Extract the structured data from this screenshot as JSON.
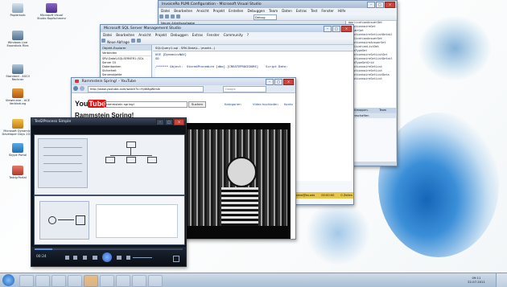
{
  "desktop": {
    "icons": [
      {
        "label": "Papierkorb"
      },
      {
        "label": "Microsoft Visual Studio Kopfschmerz"
      },
      {
        "label": "Windows Live Essentials Files"
      },
      {
        "label": "Standard - ASCII Rechner"
      },
      {
        "label": "Viewer.exe - ACE Verbindung"
      },
      {
        "label": "Microsoft Dynamics Developer Days 2010"
      },
      {
        "label": "Skype Portal"
      },
      {
        "label": "Teddy.Portal"
      }
    ]
  },
  "visual_studio": {
    "title": "InvoiceRo PLMI.Configuration - Microsoft Visual Studio",
    "menu": [
      "Datei",
      "Bearbeiten",
      "Ansicht",
      "Projekt",
      "Erstellen",
      "Debuggen",
      "Team",
      "Daten",
      "Extras",
      "Test",
      "Fenster",
      "Hilfe"
    ],
    "config": "Debug",
    "tab": "Neues Arbeitsaufgabe",
    "solution_items": [
      "ApplicationAnswerGet",
      "QuestionnaireGet",
      "AnswerGet",
      "QuestionnaireSetListDetail",
      "ApplicationAnswerSet",
      "QuestionnaireAnswerSet",
      "ApplicationListDet",
      "DataTypeGet",
      "QuestionnaireSetListGet",
      "QuestionnaireGetListDetail",
      "DataTypeGetGrid",
      "QuestionnaireGetList",
      "QuestionnaireSetList",
      "QuestionnaireGetListData",
      "QuestionnaireSetList"
    ],
    "tabs_right": [
      "Projektmappen-Explorer",
      "Team Explorer"
    ],
    "properties_label": "Eigenschaften"
  },
  "ssms": {
    "title": "Microsoft SQL Server Management Studio",
    "menu": [
      "Datei",
      "Bearbeiten",
      "Ansicht",
      "Projekt",
      "Debuggen",
      "Extras",
      "Fenster",
      "Community",
      "?"
    ],
    "new_query": "Neue Abfrage",
    "explorer_title": "Objekt-Explorer",
    "connect_label": "Verbinden",
    "tree": [
      "SRV-Data\\LSQLSERVER1 (SQL Server 10",
      "Datenbanken",
      "Sicherheit",
      "Serverobjekte",
      "Replikation",
      "Verwaltung",
      "SQL Server-Agent"
    ],
    "query_tab": "SQLQuery1.sql - SRV-Data\\L...\\markt...)",
    "code_lines": [
      "USE [DynamicsNAV]",
      "GO",
      "",
      "/****** Object:  StoredProcedure [dbo].[CREATEPROCEDURE]    Script Date:",
      "",
      "                                        ",
      "                       int, @SessionType ir"
    ],
    "status_right": [
      "tomw@ko.ads",
      "00:00:00",
      "0 Zeilen"
    ]
  },
  "youtube": {
    "title": "Rammstein Spring! - YouTube",
    "url": "http://www.youtube.com/watch?v=9j4K8gWlmIk",
    "search_placeholder": "Google",
    "search_value": "rammstein spring!",
    "search_button": "Suchen",
    "nav": [
      "Kategorien",
      "Video hochladen"
    ],
    "nav_right": "Konto",
    "video_title": "Rammstein Spring!",
    "logo_you": "You",
    "logo_tube": "Tube"
  },
  "media_player": {
    "title": "Ted2Process Simple",
    "time": "00:24",
    "colors": {
      "bg": "#0d1119",
      "play": "#3d7be0"
    }
  },
  "taskbar": {
    "clock_time": "09:11",
    "clock_date": "22.07.2011"
  }
}
